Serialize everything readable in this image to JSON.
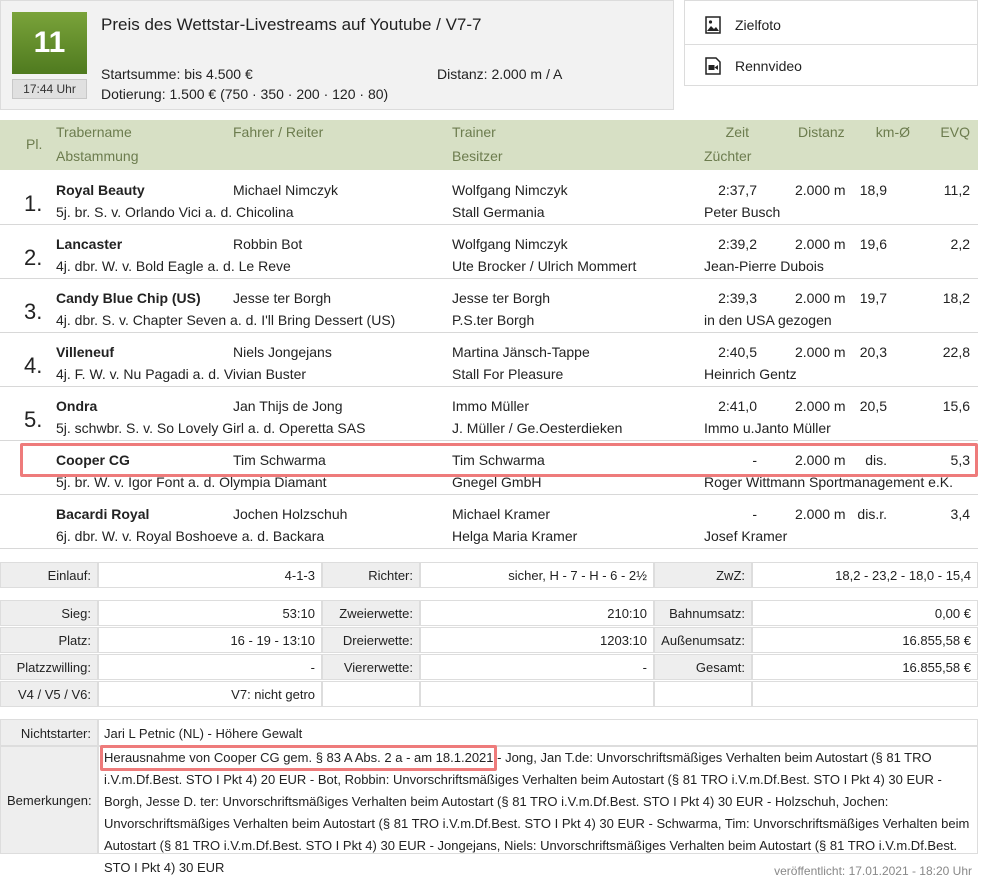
{
  "race": {
    "number": "11",
    "time": "17:44 Uhr",
    "title": "Preis des Wettstar-Livestreams auf Youtube / V7-7",
    "startsumme": "Startsumme: bis 4.500 €",
    "dotierung": "Dotierung: 1.500 € (750 · 350 · 200 · 120 · 80)",
    "distanz": "Distanz: 2.000 m / A"
  },
  "media": {
    "zielfoto": "Zielfoto",
    "rennvideo": "Rennvideo"
  },
  "table_header": {
    "pl": "Pl.",
    "trabername": "Trabername",
    "abstammung": "Abstammung",
    "fahrer": "Fahrer / Reiter",
    "trainer": "Trainer",
    "besitzer": "Besitzer",
    "zeit": "Zeit",
    "zuechter": "Züchter",
    "distanz": "Distanz",
    "km": "km-Ø",
    "evq": "EVQ"
  },
  "results": [
    {
      "place": "1.",
      "name": "Royal Beauty",
      "pedigree": "5j. br. S. v. Orlando Vici a. d. Chicolina",
      "driver": "Michael Nimczyk",
      "trainer": "Wolfgang Nimczyk",
      "owner": "Stall Germania",
      "time": "2:37,7",
      "breeder": "Peter Busch",
      "dist": "2.000 m",
      "km": "18,9",
      "evq": "11,2"
    },
    {
      "place": "2.",
      "name": "Lancaster",
      "pedigree": "4j. dbr. W. v. Bold Eagle a. d. Le Reve",
      "driver": "Robbin Bot",
      "trainer": "Wolfgang Nimczyk",
      "owner": "Ute Brocker / Ulrich Mommert",
      "time": "2:39,2",
      "breeder": "Jean-Pierre Dubois",
      "dist": "2.000 m",
      "km": "19,6",
      "evq": "2,2"
    },
    {
      "place": "3.",
      "name": "Candy Blue Chip (US)",
      "pedigree": "4j. dbr. S. v. Chapter Seven a. d. I'll Bring Dessert (US)",
      "driver": "Jesse ter Borgh",
      "trainer": "Jesse ter Borgh",
      "owner": "P.S.ter Borgh",
      "time": "2:39,3",
      "breeder": "in den USA gezogen",
      "dist": "2.000 m",
      "km": "19,7",
      "evq": "18,2"
    },
    {
      "place": "4.",
      "name": "Villeneuf",
      "pedigree": "4j. F. W. v. Nu Pagadi a. d. Vivian Buster",
      "driver": "Niels Jongejans",
      "trainer": "Martina Jänsch-Tappe",
      "owner": "Stall For Pleasure",
      "time": "2:40,5",
      "breeder": "Heinrich Gentz",
      "dist": "2.000 m",
      "km": "20,3",
      "evq": "22,8"
    },
    {
      "place": "5.",
      "name": "Ondra",
      "pedigree": "5j. schwbr. S. v. So Lovely Girl a. d. Operetta SAS",
      "driver": "Jan Thijs de Jong",
      "trainer": "Immo Müller",
      "owner": "J. Müller / Ge.Oesterdieken",
      "time": "2:41,0",
      "breeder": "Immo u.Janto Müller",
      "dist": "2.000 m",
      "km": "20,5",
      "evq": "15,6"
    },
    {
      "place": "",
      "name": "Cooper CG",
      "pedigree": "5j. br. W. v. Igor Font a. d. Olympia Diamant",
      "driver": "Tim Schwarma",
      "trainer": "Tim Schwarma",
      "owner": "Gnegel GmbH",
      "time": "-",
      "breeder": "Roger Wittmann Sportmanagement e.K.",
      "dist": "2.000 m",
      "km": "dis.",
      "evq": "5,3"
    },
    {
      "place": "",
      "name": "Bacardi Royal",
      "pedigree": "6j. dbr. W. v. Royal Boshoeve a. d. Backara",
      "driver": "Jochen Holzschuh",
      "trainer": "Michael Kramer",
      "owner": "Helga Maria Kramer",
      "time": "-",
      "breeder": "Josef Kramer",
      "dist": "2.000 m",
      "km": "dis.r.",
      "evq": "3,4"
    }
  ],
  "summary": {
    "einlauf_label": "Einlauf:",
    "einlauf": "4-1-3",
    "richter_label": "Richter:",
    "richter": "sicher, H - 7 - H - 6 - 2½",
    "zwz_label": "ZwZ:",
    "zwz": "18,2 - 23,2 - 18,0 - 15,4"
  },
  "bets": {
    "sieg_label": "Sieg:",
    "sieg": "53:10",
    "zweier_label": "Zweierwette:",
    "zweier": "210:10",
    "bahn_label": "Bahnumsatz:",
    "bahn": "0,00 €",
    "platz_label": "Platz:",
    "platz": "16 - 19 - 13:10",
    "dreier_label": "Dreierwette:",
    "dreier": "1203:10",
    "aussen_label": "Außenumsatz:",
    "aussen": "16.855,58 €",
    "pz_label": "Platzzwilling:",
    "pz": "-",
    "vierer_label": "Viererwette:",
    "vierer": "-",
    "gesamt_label": "Gesamt:",
    "gesamt": "16.855,58 €",
    "v_label": "V4 / V5 / V6:",
    "v": "V7: nicht getro"
  },
  "notes": {
    "nichtstarter_label": "Nichtstarter:",
    "nichtstarter": "Jari L Petnic (NL) - Höhere Gewalt",
    "bemerkungen_label": "Bemerkungen:",
    "bemerkungen": "Herausnahme von Cooper CG gem. § 83 A Abs. 2 a - am 18.1.2021 - Jong, Jan T.de: Unvorschriftsmäßiges Verhalten beim Autostart (§ 81 TRO i.V.m.Df.Best. STO I Pkt 4) 20 EUR - Bot, Robbin: Unvorschriftsmäßiges Verhalten beim Autostart (§ 81 TRO i.V.m.Df.Best. STO I Pkt 4) 30 EUR - Borgh, Jesse D. ter: Unvorschriftsmäßiges Verhalten beim Autostart (§ 81 TRO i.V.m.Df.Best. STO I Pkt 4) 30 EUR - Holzschuh, Jochen: Unvorschriftsmäßiges Verhalten beim Autostart (§ 81 TRO i.V.m.Df.Best. STO I Pkt 4) 30 EUR - Schwarma, Tim: Unvorschriftsmäßiges Verhalten beim Autostart (§ 81 TRO i.V.m.Df.Best. STO I Pkt 4) 30 EUR - Jongejans, Niels: Unvorschriftsmäßiges Verhalten beim Autostart (§ 81 TRO i.V.m.Df.Best. STO I Pkt 4) 30 EUR"
  },
  "published": "veröffentlicht: 17.01.2021 - 18:20 Uhr",
  "colors": {
    "accent": "#5f8a26",
    "header_bg": "#d7e0c5",
    "highlight": "#ee7b7b"
  }
}
